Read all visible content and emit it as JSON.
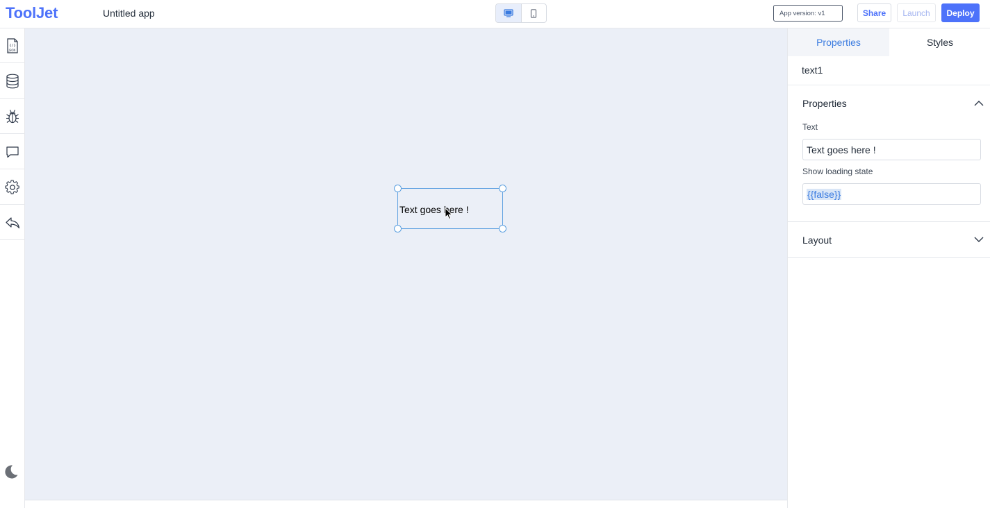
{
  "header": {
    "logo": "ToolJet",
    "app_name": "Untitled app",
    "version_label": "App version: v1",
    "share_label": "Share",
    "launch_label": "Launch",
    "deploy_label": "Deploy"
  },
  "canvas": {
    "widget_text": "Text goes here !"
  },
  "right_panel": {
    "tabs": [
      {
        "label": "Properties"
      },
      {
        "label": "Styles"
      }
    ],
    "component_name": "text1",
    "properties_section": {
      "title": "Properties",
      "fields": [
        {
          "label": "Text",
          "value": "Text goes here !"
        },
        {
          "label": "Show loading state",
          "value": "{{false}}"
        }
      ]
    },
    "layout_section": {
      "title": "Layout"
    }
  },
  "colors": {
    "brand": "#4d72fa",
    "canvas_bg": "#ebeff7",
    "selection": "#5b9fe0",
    "active_tab_text": "#3a7be0"
  }
}
